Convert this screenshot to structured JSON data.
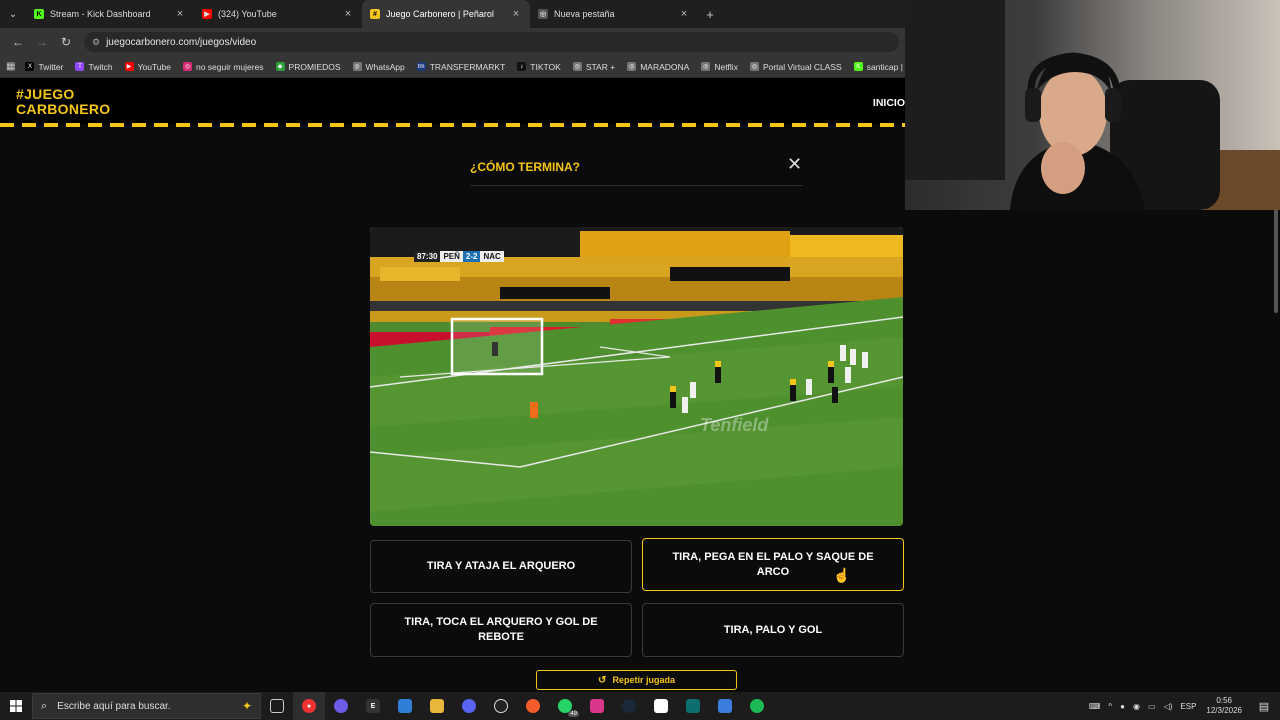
{
  "browser": {
    "tabs": [
      {
        "title": "Stream - Kick Dashboard",
        "color": "#53fc18",
        "glyph": "K",
        "active": false
      },
      {
        "title": "(324) YouTube",
        "color": "#ff0000",
        "glyph": "▶",
        "active": false
      },
      {
        "title": "Juego Carbonero | Peñarol",
        "color": "#f5c518",
        "glyph": "#",
        "active": true
      },
      {
        "title": "Nueva pestaña",
        "color": "#888888",
        "glyph": "◎",
        "active": false
      }
    ],
    "url": "juegocarbonero.com/juegos/video",
    "bookmarks": [
      {
        "label": "Twitter",
        "color": "#000000",
        "glyph": "X"
      },
      {
        "label": "Twitch",
        "color": "#9146ff",
        "glyph": "T"
      },
      {
        "label": "YouTube",
        "color": "#ff0000",
        "glyph": "▶"
      },
      {
        "label": "no seguir mujeres",
        "color": "#d62976",
        "glyph": "◎"
      },
      {
        "label": "PROMIEDOS",
        "color": "#2e9e3a",
        "glyph": "◆"
      },
      {
        "label": "WhatsApp",
        "color": "#777777",
        "glyph": "◎"
      },
      {
        "label": "TRANSFERMARKT",
        "color": "#1a3a7a",
        "glyph": "tm"
      },
      {
        "label": "TIKTOK",
        "color": "#111111",
        "glyph": "♪"
      },
      {
        "label": "STAR +",
        "color": "#777777",
        "glyph": "◎"
      },
      {
        "label": "MARADONA",
        "color": "#777777",
        "glyph": "◎"
      },
      {
        "label": "Netflix",
        "color": "#777777",
        "glyph": "◎"
      },
      {
        "label": "Portal Virtual CLASS",
        "color": "#777777",
        "glyph": "◎"
      },
      {
        "label": "santicap | Kick",
        "color": "#53fc18",
        "glyph": "K"
      }
    ]
  },
  "site": {
    "logo_line1": "#JUEGO",
    "logo_line2": "CARBONERO",
    "nav_inicio": "INICIO",
    "accent": "#f5c518"
  },
  "game": {
    "question": "¿CÓMO TERMINA?",
    "close_glyph": "✕",
    "scorebug": {
      "time": "87:30",
      "home": "PEÑ",
      "score": "2-2",
      "away": "NAC"
    },
    "video_watermark": "Tenfield",
    "options": [
      "TIRA Y ATAJA EL ARQUERO",
      "TIRA, PEGA EN EL PALO Y SAQUE DE ARCO",
      "TIRA, TOCA EL ARQUERO Y GOL DE REBOTE",
      "TIRA, PALO Y GOL"
    ],
    "replay_label": "Repetir jugada"
  },
  "taskbar": {
    "search_placeholder": "Escribe aquí para buscar.",
    "whatsapp_badge": "49",
    "language": "ESP",
    "time": "0:56",
    "date": "12/3/2026"
  }
}
